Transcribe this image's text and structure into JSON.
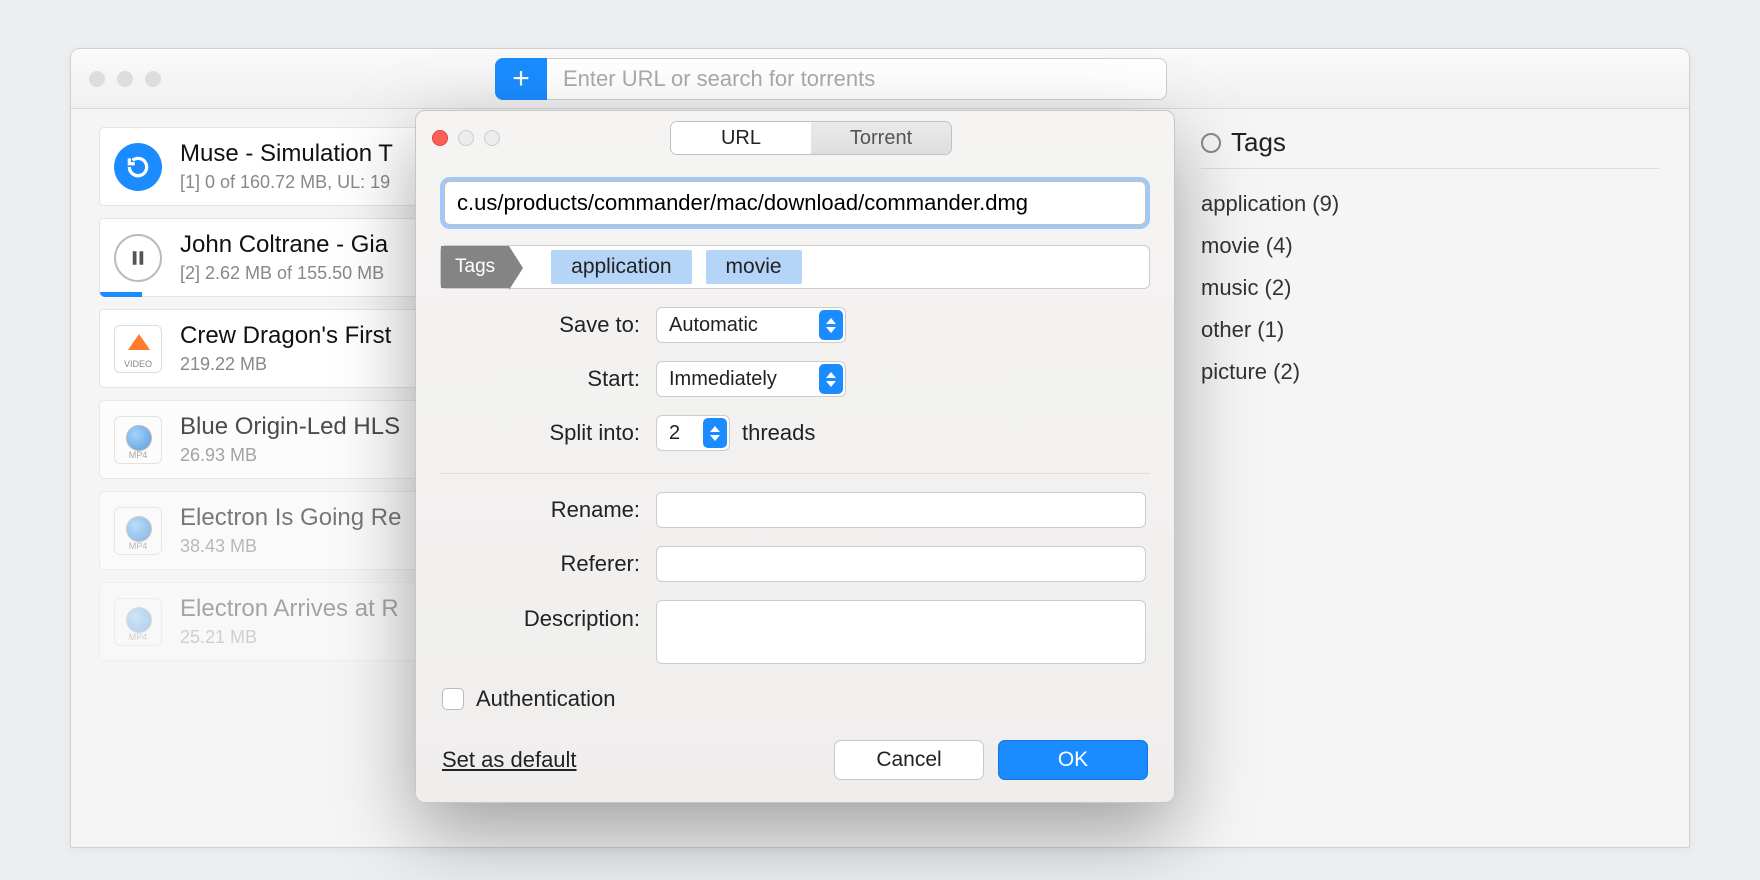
{
  "toolbar": {
    "search_placeholder": "Enter URL or search for torrents"
  },
  "downloads": [
    {
      "title": "Muse - Simulation T",
      "sub": "[1] 0 of 160.72 MB, UL: 19",
      "icon": "retry",
      "progress_pct": 0
    },
    {
      "title": "John Coltrane - Gia",
      "sub": "[2] 2.62 MB of 155.50 MB",
      "icon": "pause",
      "progress_pct": 4
    },
    {
      "title": "Crew Dragon's First",
      "sub": "219.22 MB",
      "icon": "video"
    },
    {
      "title": "Blue Origin-Led HLS",
      "sub": "26.93 MB",
      "icon": "mp4"
    },
    {
      "title": "Electron Is Going Re",
      "sub": "38.43 MB",
      "icon": "mp4"
    },
    {
      "title": "Electron Arrives at R",
      "sub": "25.21 MB",
      "icon": "mp4"
    }
  ],
  "sidebar": {
    "title": "Tags",
    "items": [
      "application (9)",
      "movie (4)",
      "music (2)",
      "other (1)",
      "picture (2)"
    ]
  },
  "dialog": {
    "tabs": {
      "url": "URL",
      "torrent": "Torrent"
    },
    "url_value": "c.us/products/commander/mac/download/commander.dmg",
    "tags_label": "Tags",
    "tag_chips": [
      "application",
      "movie"
    ],
    "labels": {
      "save_to": "Save to:",
      "start": "Start:",
      "split_into": "Split into:",
      "threads": "threads",
      "rename": "Rename:",
      "referer": "Referer:",
      "description": "Description:",
      "authentication": "Authentication",
      "set_default": "Set as default",
      "cancel": "Cancel",
      "ok": "OK"
    },
    "values": {
      "save_to": "Automatic",
      "start": "Immediately",
      "split_into": "2",
      "rename": "",
      "referer": "",
      "description": ""
    }
  }
}
